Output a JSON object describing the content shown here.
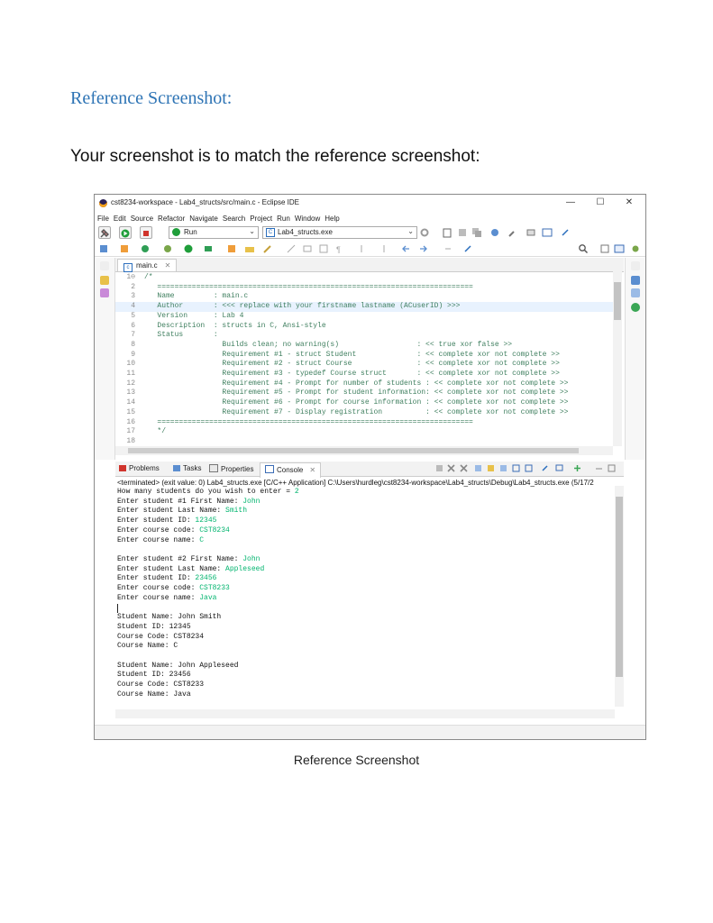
{
  "document": {
    "heading": "Reference Screenshot:",
    "intro": "Your screenshot is to match the reference screenshot:",
    "caption": "Reference Screenshot"
  },
  "window": {
    "title": "cst8234-workspace - Lab4_structs/src/main.c - Eclipse IDE",
    "minimize": "—",
    "maximize": "☐",
    "close": "✕"
  },
  "menubar": [
    "File",
    "Edit",
    "Source",
    "Refactor",
    "Navigate",
    "Search",
    "Project",
    "Run",
    "Window",
    "Help"
  ],
  "toolbar": {
    "run_mode": "Run",
    "launch_target": "Lab4_structs.exe"
  },
  "editor": {
    "tab": "main.c",
    "lines": [
      {
        "n": "1⊖",
        "t": "/*"
      },
      {
        "n": "2",
        "t": "   ========================================================================="
      },
      {
        "n": "3",
        "t": "   Name         : main.c"
      },
      {
        "n": "4",
        "t": "   Author       : <<< replace with your firstname lastname (ACuserID) >>>"
      },
      {
        "n": "5",
        "t": "   Version      : Lab 4"
      },
      {
        "n": "6",
        "t": "   Description  : structs in C, Ansi-style"
      },
      {
        "n": "7",
        "t": "   Status       :"
      },
      {
        "n": "8",
        "t": "                  Builds clean; no warning(s)                  : << true xor false >>"
      },
      {
        "n": "9",
        "t": "                  Requirement #1 - struct Student              : << complete xor not complete >>"
      },
      {
        "n": "10",
        "t": "                  Requirement #2 - struct Course               : << complete xor not complete >>"
      },
      {
        "n": "11",
        "t": "                  Requirement #3 - typedef Course struct       : << complete xor not complete >>"
      },
      {
        "n": "12",
        "t": "                  Requirement #4 - Prompt for number of students : << complete xor not complete >>"
      },
      {
        "n": "13",
        "t": "                  Requirement #5 - Prompt for student information: << complete xor not complete >>"
      },
      {
        "n": "14",
        "t": "                  Requirement #6 - Prompt for course information : << complete xor not complete >>"
      },
      {
        "n": "15",
        "t": "                  Requirement #7 - Display registration          : << complete xor not complete >>"
      },
      {
        "n": "16",
        "t": "   ========================================================================="
      },
      {
        "n": "17",
        "t": "   */"
      },
      {
        "n": "18",
        "t": ""
      }
    ]
  },
  "console": {
    "tabs": [
      "Problems",
      "Tasks",
      "Properties",
      "Console"
    ],
    "terminated": "<terminated> (exit value: 0) Lab4_structs.exe [C/C++ Application] C:\\Users\\hurdleg\\cst8234-workspace\\Lab4_structs\\Debug\\Lab4_structs.exe (5/17/2",
    "lines": [
      {
        "p": "How many students do you wish to enter = ",
        "i": "2"
      },
      {
        "p": "Enter student #1 First Name: ",
        "i": "John"
      },
      {
        "p": "Enter student Last Name: ",
        "i": "Smith"
      },
      {
        "p": "Enter student ID: ",
        "i": "12345"
      },
      {
        "p": "Enter course code: ",
        "i": "CST8234"
      },
      {
        "p": "Enter course name: ",
        "i": "C"
      },
      {
        "p": "",
        "i": ""
      },
      {
        "p": "Enter student #2 First Name: ",
        "i": "John"
      },
      {
        "p": "Enter student Last Name: ",
        "i": "Appleseed"
      },
      {
        "p": "Enter student ID: ",
        "i": "23456"
      },
      {
        "p": "Enter course code: ",
        "i": "CST8233"
      },
      {
        "p": "Enter course name: ",
        "i": "Java"
      },
      {
        "p": "",
        "i": ""
      },
      {
        "p": "Student Name: John Smith",
        "i": ""
      },
      {
        "p": "Student ID: 12345",
        "i": ""
      },
      {
        "p": "Course Code: CST8234",
        "i": ""
      },
      {
        "p": "Course Name: C",
        "i": ""
      },
      {
        "p": "",
        "i": ""
      },
      {
        "p": "Student Name: John Appleseed",
        "i": ""
      },
      {
        "p": "Student ID: 23456",
        "i": ""
      },
      {
        "p": "Course Code: CST8233",
        "i": ""
      },
      {
        "p": "Course Name: Java",
        "i": ""
      }
    ]
  },
  "colors": {
    "heading": "#2e74b5",
    "comment": "#3f7f5f",
    "console_input": "#00b46e"
  }
}
